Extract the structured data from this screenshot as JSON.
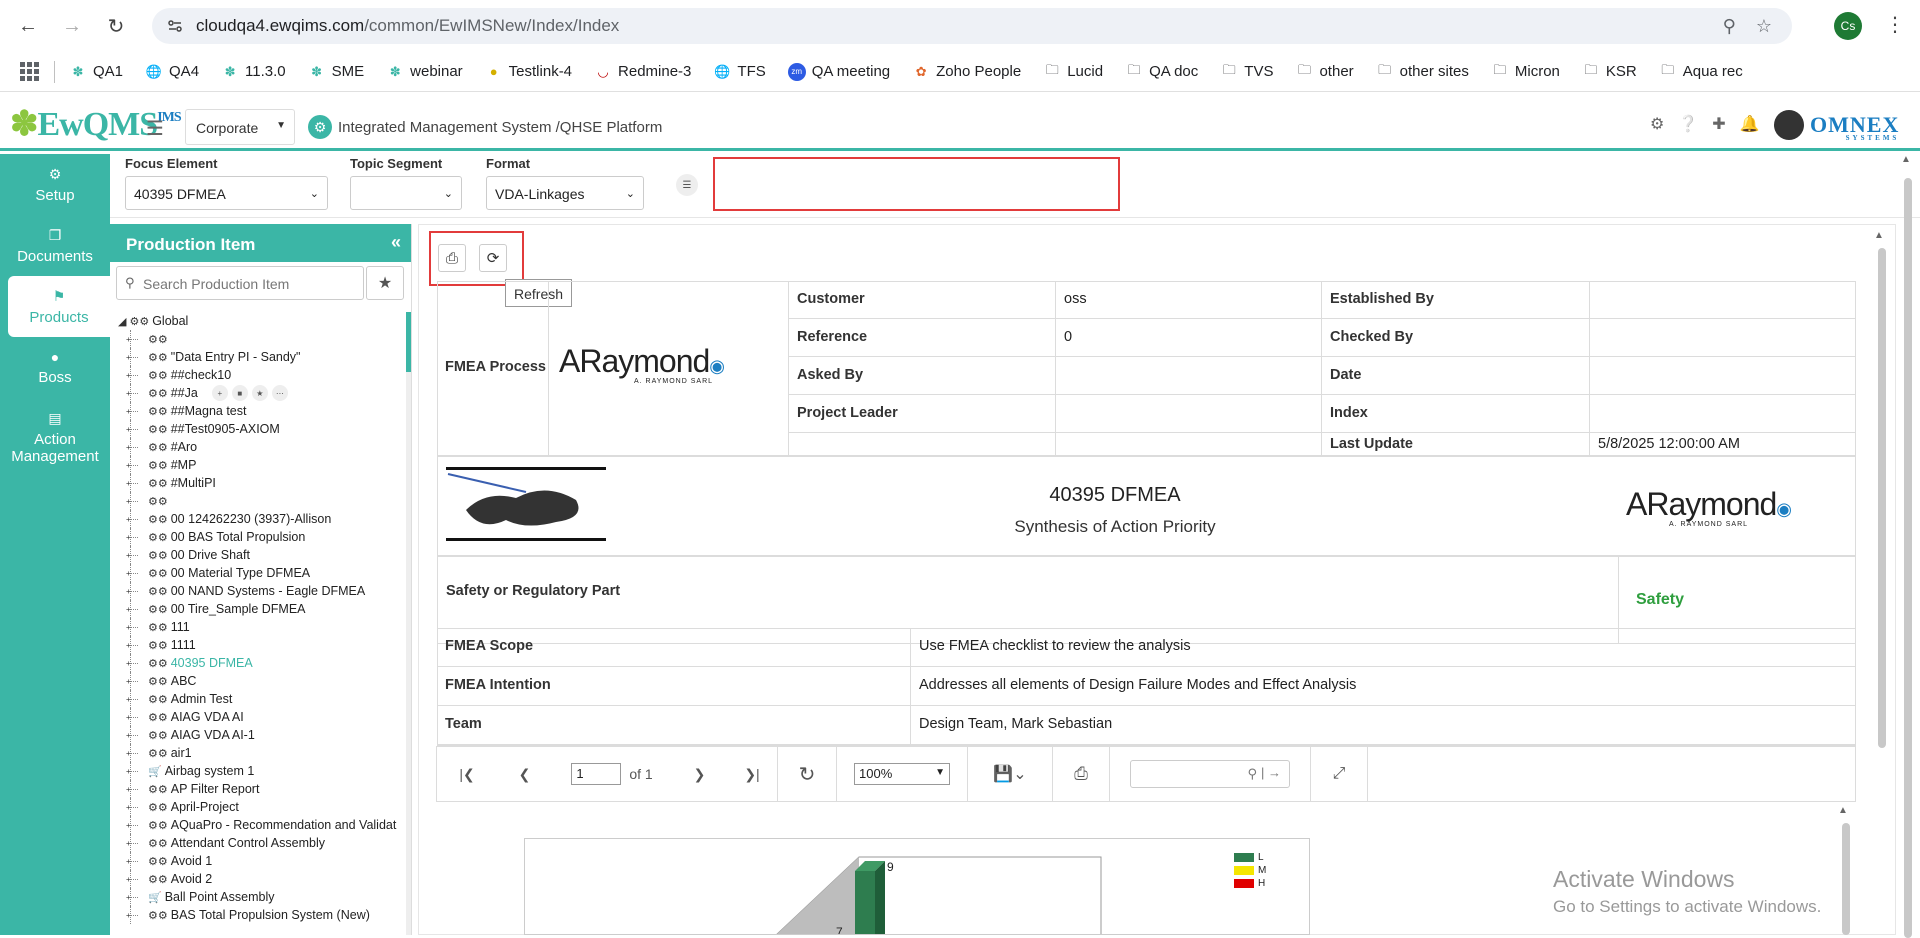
{
  "browser": {
    "url_host": "cloudqa4.ewqims.com",
    "url_path": "/common/EwIMSNew/Index/Index",
    "profile_initials": "Cs",
    "bookmarks": [
      "QA1",
      "QA4",
      "11.3.0",
      "SME",
      "webinar",
      "Testlink-4",
      "Redmine-3",
      "TFS",
      "QA meeting",
      "Zoho People",
      "Lucid",
      "QA doc",
      "TVS",
      "other",
      "other sites",
      "Micron",
      "KSR",
      "Aqua rec"
    ]
  },
  "header": {
    "logo_text": "EwQMS",
    "logo_sup": "IMS",
    "company_select": "Corporate",
    "platform_title": "Integrated Management System /QHSE Platform",
    "brand": "OMNEX",
    "brand_sub": "SYSTEMS"
  },
  "leftnav": {
    "items": [
      {
        "label": "Setup",
        "icon": "gears-icon"
      },
      {
        "label": "Documents",
        "icon": "copy-icon"
      },
      {
        "label": "Products",
        "icon": "flag-icon"
      },
      {
        "label": "Boss",
        "icon": "user-icon"
      },
      {
        "label": "Action Management",
        "icon": "clipboard-icon"
      }
    ]
  },
  "filters": {
    "focus_label": "Focus Element",
    "focus_value": "40395 DFMEA",
    "topic_label": "Topic Segment",
    "topic_value": "",
    "format_label": "Format",
    "format_value": "VDA-Linkages"
  },
  "sidebar": {
    "title": "Production Item",
    "search_placeholder": "Search Production Item",
    "root": "Global",
    "items": [
      "",
      "\"Data Entry PI - Sandy\"",
      "##check10",
      "##Ja",
      "##Magna test",
      "##Test0905-AXIOM",
      "#Aro",
      "#MP",
      "#MultiPI",
      "",
      "00 124262230 (3937)-Allison",
      "00 BAS Total Propulsion",
      "00 Drive Shaft",
      "00 Material Type DFMEA",
      "00 NAND Systems - Eagle DFMEA",
      "00 Tire_Sample DFMEA",
      "111",
      "1111",
      "40395 DFMEA",
      "ABC",
      "Admin Test",
      "AIAG VDA AI",
      "AIAG VDA AI-1",
      "air1",
      "Airbag system 1",
      "AP Filter Report",
      "April-Project",
      "AQuaPro - Recommendation and Validat",
      "Attendant Control Assembly",
      "Avoid 1",
      "Avoid 2",
      "Ball Point Assembly",
      "BAS Total Propulsion System (New)"
    ],
    "selected": "40395 DFMEA"
  },
  "toolbar": {
    "tooltip": "Refresh"
  },
  "report": {
    "fmea_process_label": "FMEA Process",
    "logo": "ARaymond",
    "logo_sub": "A. RAYMOND SARL",
    "rows": [
      {
        "l1": "Customer",
        "v1": "oss",
        "l2": "Established By",
        "v2": ""
      },
      {
        "l1": "Reference",
        "v1": "0",
        "l2": "Checked By",
        "v2": ""
      },
      {
        "l1": "Asked By",
        "v1": "",
        "l2": "Date",
        "v2": ""
      },
      {
        "l1": "Project Leader",
        "v1": "",
        "l2": "Index",
        "v2": ""
      },
      {
        "l1": "",
        "v1": "",
        "l2": "Last Update",
        "v2": "5/8/2025 12:00:00 AM"
      }
    ],
    "title": "40395 DFMEA",
    "subtitle": "Synthesis of Action Priority",
    "safety_label": "Safety or Regulatory Part",
    "safety_value": "Safety",
    "safety_color": "#2e9e3e",
    "scope_label": "FMEA Scope",
    "scope_value": "Use FMEA checklist to review the analysis",
    "intention_label": "FMEA Intention",
    "intention_value": "Addresses all elements of Design Failure Modes and Effect Analysis",
    "team_label": "Team",
    "team_value": "Design Team, Mark Sebastian"
  },
  "viewer": {
    "page": "1",
    "of_pages": "of 1",
    "zoom": "100%"
  },
  "chart_data": {
    "type": "bar",
    "legend": [
      {
        "name": "L",
        "color": "#2e7d4f"
      },
      {
        "name": "M",
        "color": "#f5e600"
      },
      {
        "name": "H",
        "color": "#e00000"
      }
    ],
    "visible_labels": [
      "9",
      "7"
    ]
  },
  "watermark": {
    "line1": "Activate Windows",
    "line2": "Go to Settings to activate Windows."
  }
}
